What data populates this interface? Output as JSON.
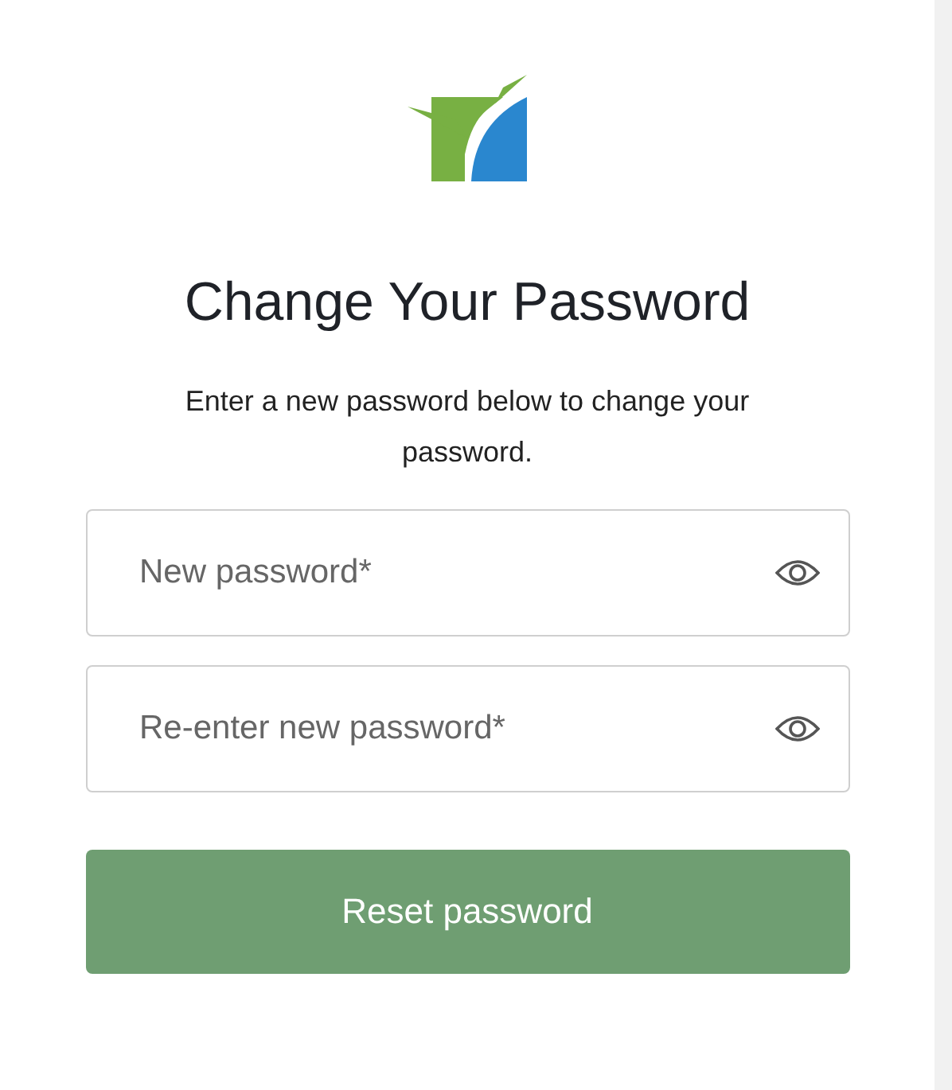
{
  "title": "Change Your Password",
  "description": "Enter a new password below to change your password.",
  "fields": [
    {
      "placeholder": "New password*"
    },
    {
      "placeholder": "Re-enter new password*"
    }
  ],
  "submit": "Reset password"
}
